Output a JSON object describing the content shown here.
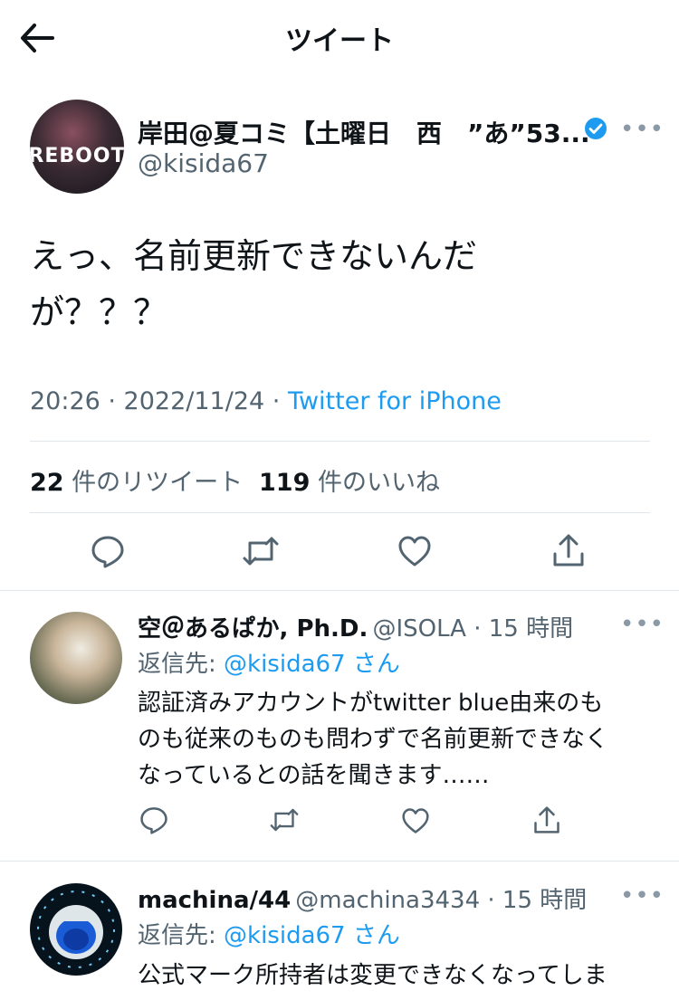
{
  "header": {
    "title": "ツイート"
  },
  "tweet": {
    "author_name": "岸田@夏コミ【土曜日　西　”あ”53...",
    "author_handle": "@kisida67",
    "text_line1": "えっ、名前更新できないんだ",
    "text_line2": "が？？？",
    "time": "20:26 · 2022/11/24 · ",
    "source": "Twitter for iPhone",
    "retweet_count": "22",
    "retweet_label": "件のリツイート",
    "like_count": "119",
    "like_label": "件のいいね",
    "avatar_text": "REBOOT"
  },
  "replies": [
    {
      "name": "空＠あるぱか, Ph.D.",
      "handle": "@ISOLA · 15 時間",
      "reply_prefix": "返信先: ",
      "reply_to": "@kisida67 さん",
      "lines": [
        "認証済みアカウントがtwitter blue由来のも",
        "のも従来のものも問わずで名前更新できなく",
        "なっているとの話を聞きます……"
      ]
    },
    {
      "name": "machina/44",
      "handle": "@machina3434 · 15 時間",
      "reply_prefix": "返信先: ",
      "reply_to": "@kisida67 さん",
      "lines": [
        "公式マーク所持者は変更できなくなってしま"
      ]
    }
  ],
  "colors": {
    "link": "#1d9bf0",
    "muted": "#536471",
    "text": "#0f1419"
  }
}
